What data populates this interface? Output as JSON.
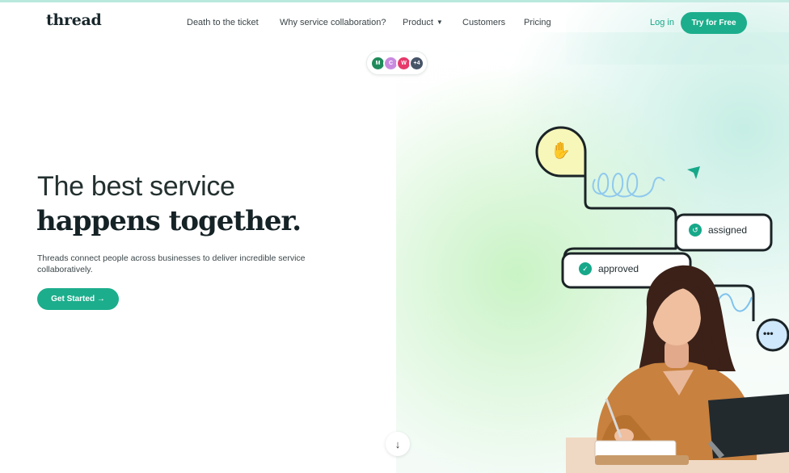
{
  "nav": {
    "logo": "thread",
    "links": [
      "Death to the ticket",
      "Why service collaboration?",
      "Product",
      "Customers",
      "Pricing"
    ],
    "login": "Log in",
    "cta": "Try for Free"
  },
  "avatars": [
    {
      "initial": "M",
      "color": "#1f8a5b"
    },
    {
      "initial": "C",
      "color": "#c88be0"
    },
    {
      "initial": "W",
      "color": "#e63a6a"
    },
    {
      "initial": "+4",
      "color": "#475569"
    }
  ],
  "hero": {
    "line1": "The best service",
    "line2": "happens together.",
    "subtitle": "Threads connect people across businesses to deliver incredible service collaboratively.",
    "cta": "Get Started →"
  },
  "illustration": {
    "tag_assigned": "assigned",
    "tag_approved": "approved",
    "chat_dots": "•••"
  },
  "colors": {
    "brand": "#1cae8c",
    "brand_text": "#16a889",
    "heading": "#152226"
  },
  "icons": {
    "chevron": "chevron-down-icon",
    "scroll": "arrow-down-icon",
    "wave": "waving-hand-icon",
    "cursor": "pointer-arrow-icon"
  }
}
